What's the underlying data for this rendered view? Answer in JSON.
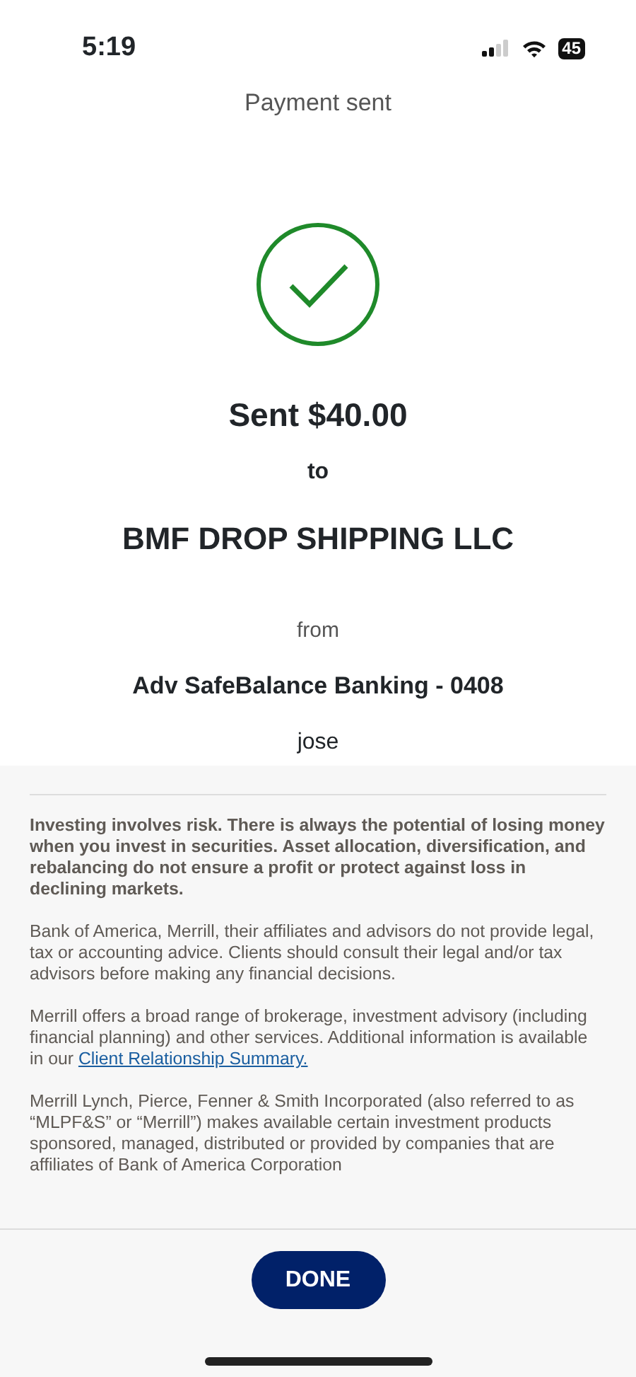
{
  "status_bar": {
    "time": "5:19",
    "battery": "45"
  },
  "header": {
    "title": "Payment sent"
  },
  "confirmation": {
    "amount": "Sent $40.00",
    "to_label": "to",
    "payee": "BMF DROP SHIPPING LLC",
    "from_label": "from",
    "account": "Adv SafeBalance Banking - 0408",
    "memo": "jose"
  },
  "disclosures": [
    {
      "emphasis": true,
      "text": "Investing involves risk. There is always the potential of losing money when you invest in securities. Asset allocation, diversification, and rebalancing do not ensure a profit or protect against loss in declining markets."
    },
    {
      "emphasis": false,
      "text": "Bank of America, Merrill, their affiliates and advisors do not provide legal, tax or accounting advice. Clients should consult their legal and/or tax advisors before making any financial decisions."
    },
    {
      "emphasis": false,
      "text": "Merrill offers a broad range of brokerage, investment advisory (including financial planning) and other services. Additional information is available in our",
      "link": "Client Relationship Summary."
    },
    {
      "emphasis": false,
      "text": "Merrill Lynch, Pierce, Fenner & Smith Incorporated (also referred to as “MLPF&S” or “Merrill”) makes available certain investment products sponsored, managed, distributed or provided by companies that are affiliates of Bank of America Corporation"
    }
  ],
  "footer": {
    "button": "DONE"
  }
}
